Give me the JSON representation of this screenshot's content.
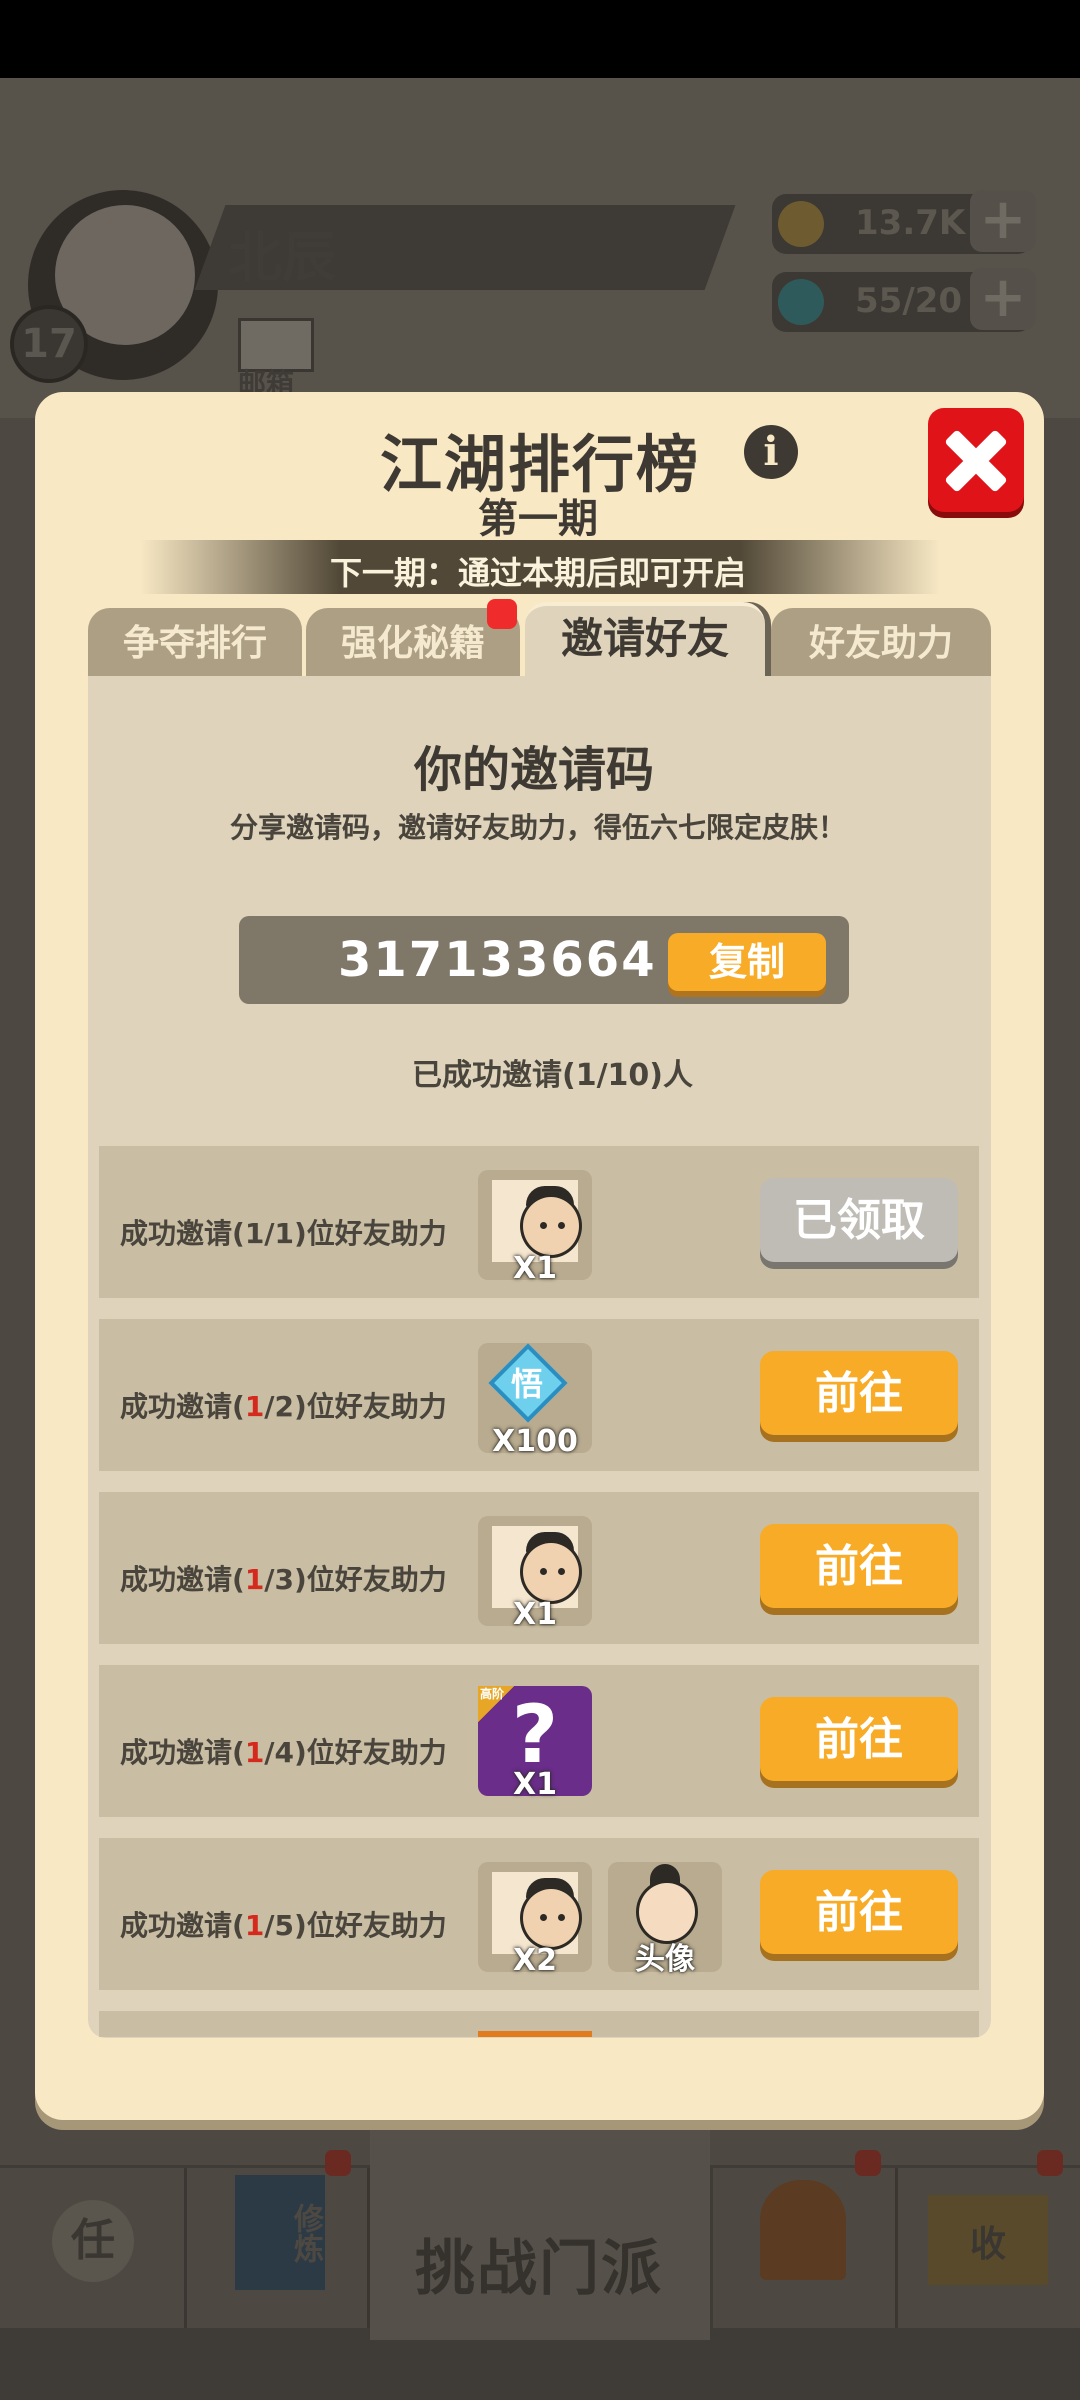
{
  "background": {
    "player_name": "北辰",
    "level": "17",
    "mail_label": "邮箱",
    "coins": "13.7K",
    "energy": "55/20",
    "plus_label": "+",
    "bottom_center_label": "挑战门派",
    "bottom_task_label": "任",
    "bottom_book_label": "修炼",
    "bottom_collect_label": "收"
  },
  "modal": {
    "title": "江湖排行榜",
    "subtitle": "第一期",
    "banner": "下一期：通过本期后即可开启",
    "info_icon": "i",
    "close_icon": "close-icon"
  },
  "tabs": [
    {
      "label": "争夺排行",
      "active": false
    },
    {
      "label": "强化秘籍",
      "active": false,
      "badge": true
    },
    {
      "label": "邀请好友",
      "active": true
    },
    {
      "label": "好友助力",
      "active": false
    }
  ],
  "invite": {
    "title": "你的邀请码",
    "description": "分享邀请码，邀请好友助力，得伍六七限定皮肤！",
    "code": "317133664",
    "copy_label": "复制",
    "invited_count": "已成功邀请(1/10)人"
  },
  "rewards": [
    {
      "prefix": "成功邀请(",
      "progress": "1",
      "mid": "/1)位好友助力",
      "highlight": false,
      "items": [
        {
          "icon": "puzzle-avatar-icon",
          "qty": "X1"
        }
      ],
      "button": "已领取",
      "claimed": true
    },
    {
      "prefix": "成功邀请(",
      "progress": "1",
      "mid": "/2)位好友助力",
      "highlight": true,
      "items": [
        {
          "icon": "insight-diamond-icon",
          "char": "悟",
          "qty": "X100"
        }
      ],
      "button": "前往",
      "claimed": false
    },
    {
      "prefix": "成功邀请(",
      "progress": "1",
      "mid": "/3)位好友助力",
      "highlight": true,
      "items": [
        {
          "icon": "puzzle-avatar-icon",
          "qty": "X1"
        }
      ],
      "button": "前往",
      "claimed": false
    },
    {
      "prefix": "成功邀请(",
      "progress": "1",
      "mid": "/4)位好友助力",
      "highlight": true,
      "items": [
        {
          "icon": "mystery-box-icon",
          "tag": "高阶",
          "qty": "X1"
        }
      ],
      "button": "前往",
      "claimed": false
    },
    {
      "prefix": "成功邀请(",
      "progress": "1",
      "mid": "/5)位好友助力",
      "highlight": true,
      "items": [
        {
          "icon": "puzzle-avatar-icon",
          "qty": "X2"
        },
        {
          "icon": "portrait-avatar-icon",
          "qty": "头像"
        }
      ],
      "button": "前往",
      "claimed": false
    }
  ],
  "colors": {
    "modal_bg": "#f8e8c4",
    "panel_bg": "#dfd4bb",
    "button_orange": "#f8ab26",
    "close_red": "#e01418",
    "highlight_red": "#d42a1e"
  }
}
